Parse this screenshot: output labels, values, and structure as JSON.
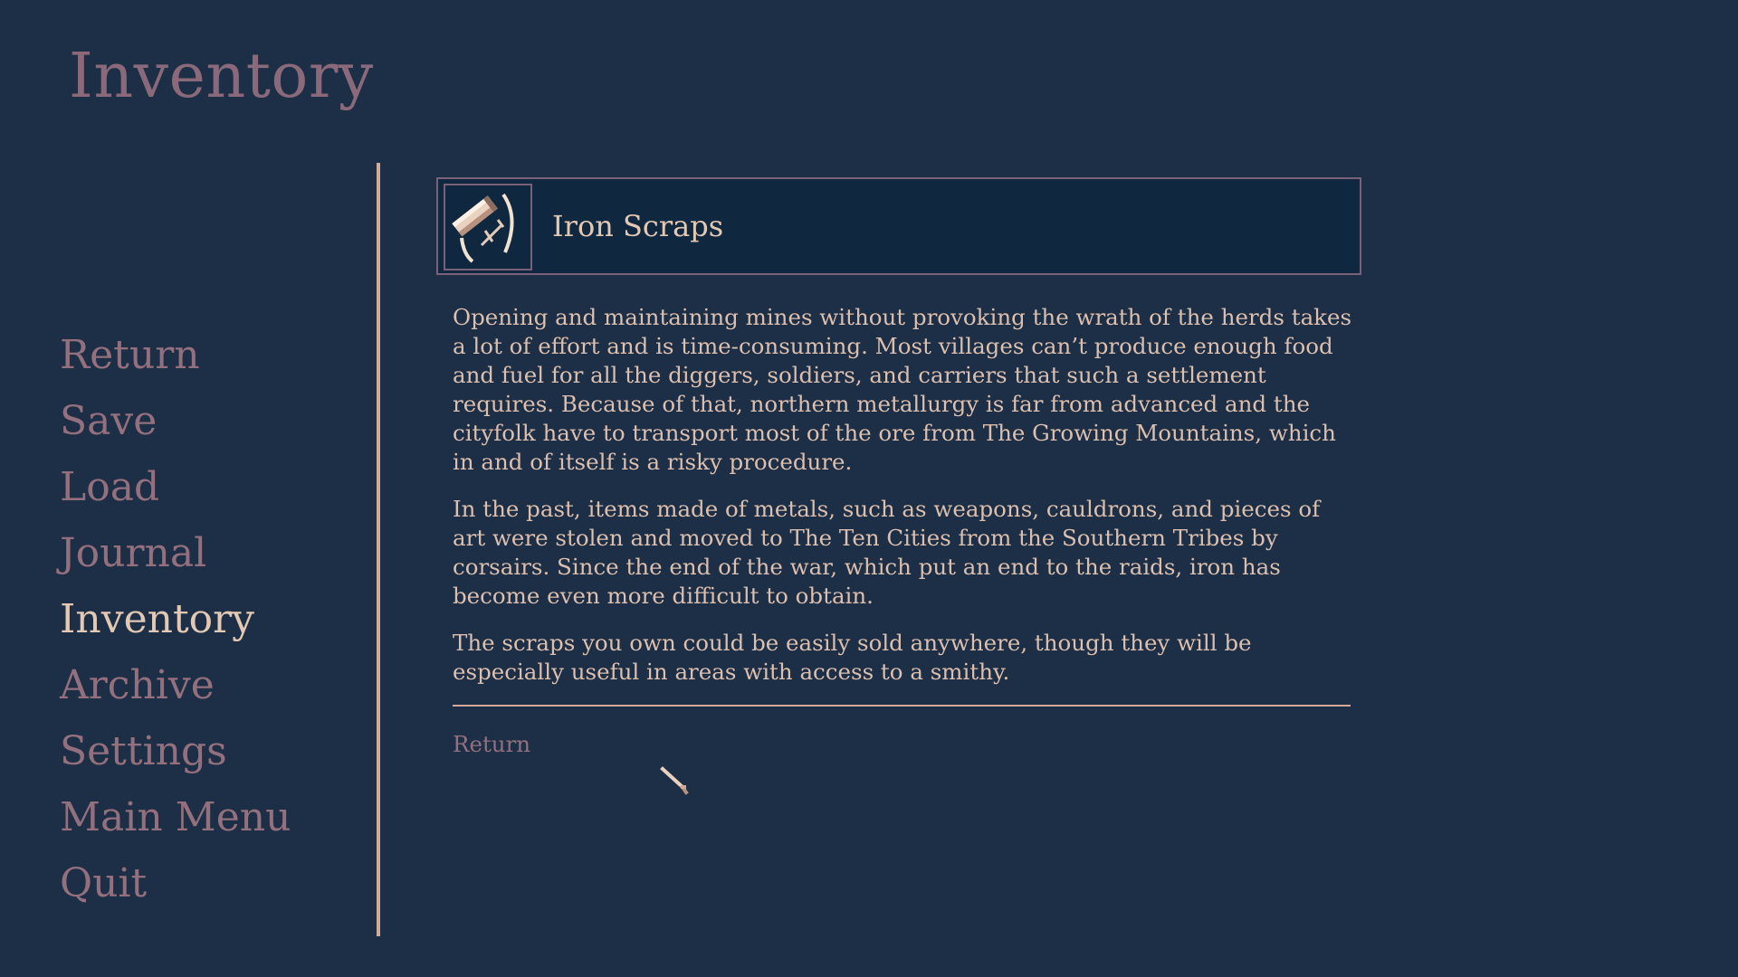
{
  "screen": {
    "title": "Inventory"
  },
  "menu": {
    "items": [
      {
        "label": "Return"
      },
      {
        "label": "Save"
      },
      {
        "label": "Load"
      },
      {
        "label": "Journal"
      },
      {
        "label": "Inventory"
      },
      {
        "label": "Archive"
      },
      {
        "label": "Settings"
      },
      {
        "label": "Main Menu"
      },
      {
        "label": "Quit"
      }
    ],
    "selected": "Inventory"
  },
  "item": {
    "name": "Iron Scraps",
    "icon": "iron-scraps-icon",
    "description": [
      "Opening and maintaining mines without provoking the wrath of the herds takes a lot of effort and is time-consuming. Most villages can’t produce enough food and fuel for all the diggers, soldiers, and carriers that such a settlement requires. Because of that, northern metallurgy is far from advanced and the cityfolk have to transport most of the ore from The Growing Mountains, which in and of itself is a risky procedure.",
      "In the past, items made of metals, such as weapons, cauldrons, and pieces of art were stolen and moved to The Ten Cities from the Southern Tribes by corsairs. Since the end of the war, which put an end to the raids, iron has become even more difficult to obtain.",
      "The scraps you own could be easily sold anywhere, though they will be especially useful in areas with access to a smithy."
    ]
  },
  "actions": {
    "return_label": "Return"
  },
  "colors": {
    "background": "#1d2f46",
    "panel": "#0f2840",
    "accent_pink": "#94707e",
    "text_cream": "#e3c8b4",
    "divider": "#d3a999"
  }
}
